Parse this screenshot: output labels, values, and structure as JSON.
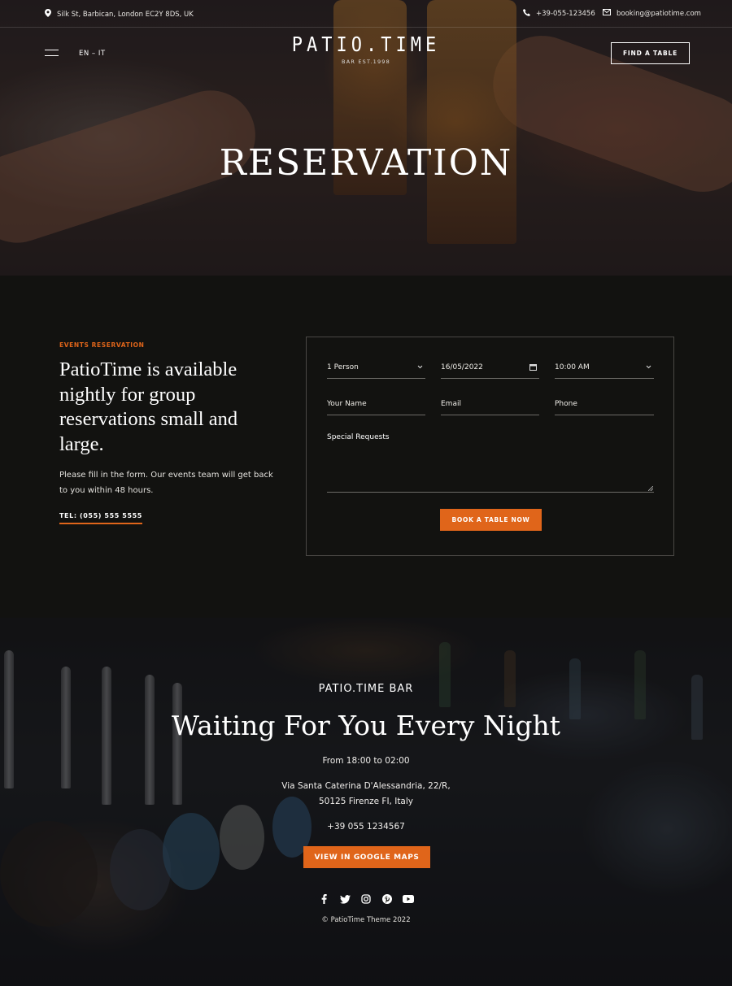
{
  "topbar": {
    "address": "Silk St, Barbican, London EC2Y 8DS, UK",
    "phone": "+39-055-123456",
    "email": "booking@patiotime.com"
  },
  "nav": {
    "lang": "EN – IT",
    "logo_name": "PATIO.TIME",
    "logo_sub": "BAR EST.1998",
    "cta": "FIND A TABLE"
  },
  "hero": {
    "title": "RESERVATION"
  },
  "reservation": {
    "eyebrow": "EVENTS RESERVATION",
    "heading": "PatioTime is available nightly for group reservations small and large.",
    "lead": "Please fill in the form. Our events team will get back to you within 48 hours.",
    "tel": "TEL: (055) 555 5555"
  },
  "form": {
    "persons": "1 Person",
    "date": "16/05/2022",
    "time": "10:00 AM",
    "name_placeholder": "Your Name",
    "email_placeholder": "Email",
    "phone_placeholder": "Phone",
    "requests_placeholder": "Special Requests",
    "submit": "BOOK A TABLE NOW"
  },
  "footer": {
    "eyebrow": "PATIO.TIME BAR",
    "title": "Waiting For You Every Night",
    "hours": "From 18:00 to 02:00",
    "address_line1": "Via Santa Caterina D'Alessandria, 22/R,",
    "address_line2": "50125 Firenze FI, Italy",
    "phone": "+39 055 1234567",
    "maps_button": "VIEW IN GOOGLE MAPS",
    "socials": [
      "facebook-icon",
      "twitter-icon",
      "instagram-icon",
      "pinterest-icon",
      "youtube-icon"
    ],
    "copyright": "© PatioTime Theme 2022"
  },
  "colors": {
    "accent": "#e0651a",
    "background": "#121210"
  }
}
